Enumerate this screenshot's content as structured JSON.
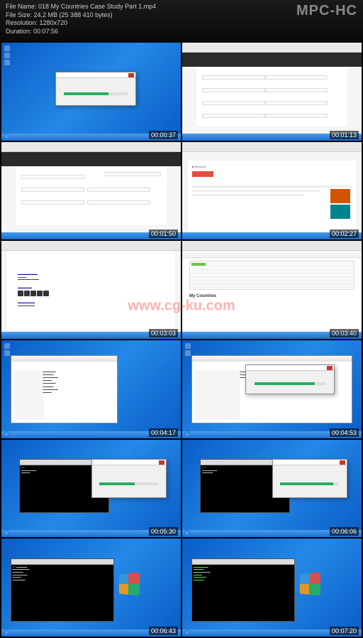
{
  "header": {
    "file_name_label": "File Name:",
    "file_name_value": "018 My Countries Case Study Part 1.mp4",
    "file_size_label": "File Size:",
    "file_size_value": "24,2 MB (25 388 410 bytes)",
    "resolution_label": "Resolution:",
    "resolution_value": "1280x720",
    "duration_label": "Duration:",
    "duration_value": "00:07:56",
    "logo": "MPC-HC"
  },
  "timestamps": [
    "00:00:37",
    "00:01:13",
    "00:01:50",
    "00:02:27",
    "00:03:03",
    "00:03:40",
    "00:04:17",
    "00:04:53",
    "00:05:30",
    "00:06:06",
    "00:06:43",
    "00:07:20"
  ],
  "github": {
    "heading": "My Countries"
  },
  "watermark": "www.cg-ku.com"
}
